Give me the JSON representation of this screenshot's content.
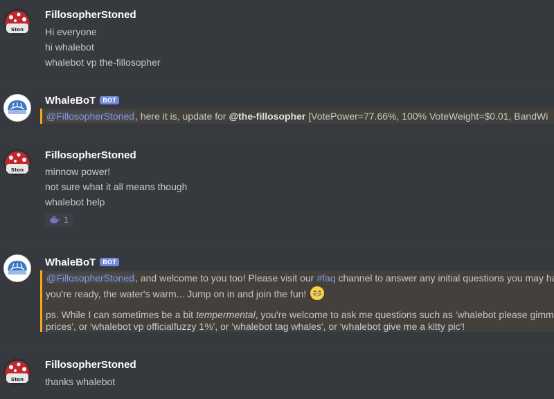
{
  "messages": [
    {
      "author": "FillosopherStoned",
      "lines": [
        "Hi everyone",
        "hi whalebot",
        "whalebot vp the-fillosopher"
      ]
    },
    {
      "author": "WhaleBoT",
      "bot_tag": "BOT",
      "mention": "@FillosopherStoned",
      "text_a": ", here it is, update for ",
      "bold_mention": "@the-fillosopher",
      "text_b": "  [VotePower=77.66%, 100% VoteWeight=$0.01, BandWi"
    },
    {
      "author": "FillosopherStoned",
      "lines": [
        "minnow power!",
        "not sure what it all means though",
        "whalebot help"
      ],
      "reaction": {
        "emoji": "whale-icon",
        "count": "1"
      }
    },
    {
      "author": "WhaleBoT",
      "bot_tag": "BOT",
      "mention": "@FillosopherStoned",
      "text_a": ", and welcome to you too! Please visit our ",
      "channel": "#faq",
      "text_b": " channel to answer any initial questions you may ha",
      "line2": "you're ready, the water's warm... Jump on in and join the fun!",
      "ps_a": "ps. While I can sometimes be a bit ",
      "ps_em": "tempermental",
      "ps_b": ", you're welcome to ask me questions such as 'whalebot please gimme",
      "ps_line2": "prices', or 'whalebot vp officialfuzzy 1%', or 'whalebot tag whales', or 'whalebot give me a kitty pic'!"
    },
    {
      "author": "FillosopherStoned",
      "lines": [
        "thanks whalebot"
      ]
    }
  ],
  "colors": {
    "background": "#36393e",
    "username": "#ffffff",
    "text": "#c7c9cb",
    "mention": "#7f9ade",
    "bot_tag": "#7289da",
    "highlight_border": "#faa61a"
  }
}
